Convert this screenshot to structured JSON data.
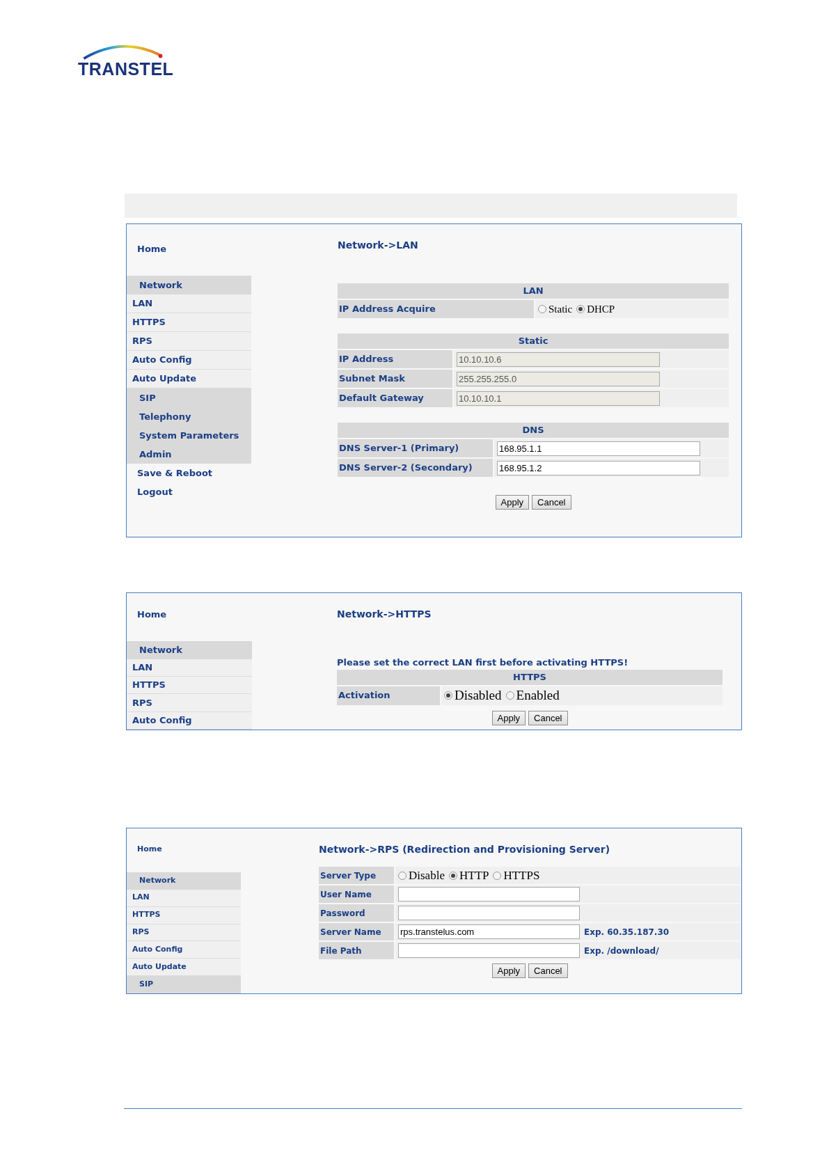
{
  "logo": {
    "text": "TRANSTEL"
  },
  "panels": [
    {
      "sidebar": [
        {
          "label": "Home",
          "kind": "link"
        },
        {
          "label": "Network",
          "kind": "section"
        },
        {
          "label": "LAN",
          "kind": "item"
        },
        {
          "label": "HTTPS",
          "kind": "item"
        },
        {
          "label": "RPS",
          "kind": "item"
        },
        {
          "label": "Auto Config",
          "kind": "item"
        },
        {
          "label": "Auto Update",
          "kind": "item"
        },
        {
          "label": "SIP",
          "kind": "sub"
        },
        {
          "label": "Telephony",
          "kind": "sub"
        },
        {
          "label": "System Parameters",
          "kind": "sub"
        },
        {
          "label": "Admin",
          "kind": "sub"
        },
        {
          "label": "Save & Reboot",
          "kind": "link"
        },
        {
          "label": "Logout",
          "kind": "link"
        }
      ],
      "title": "Network->LAN",
      "groups": [
        {
          "heading": "LAN",
          "rows": [
            {
              "label": "IP Address Acquire",
              "kind": "radio",
              "options": [
                {
                  "label": "Static",
                  "selected": false
                },
                {
                  "label": "DHCP",
                  "selected": true
                }
              ]
            }
          ]
        },
        {
          "heading": "Static",
          "rows": [
            {
              "label": "IP Address",
              "kind": "input",
              "value": "10.10.10.6",
              "disabled": true
            },
            {
              "label": "Subnet Mask",
              "kind": "input",
              "value": "255.255.255.0",
              "disabled": true
            },
            {
              "label": "Default Gateway",
              "kind": "input",
              "value": "10.10.10.1",
              "disabled": true
            }
          ]
        },
        {
          "heading": "DNS",
          "rows": [
            {
              "label": "DNS Server-1 (Primary)",
              "kind": "input",
              "value": "168.95.1.1",
              "disabled": false
            },
            {
              "label": "DNS Server-2 (Secondary)",
              "kind": "input",
              "value": "168.95.1.2",
              "disabled": false
            }
          ]
        }
      ],
      "buttons": [
        "Apply",
        "Cancel"
      ]
    },
    {
      "sidebar": [
        {
          "label": "Home",
          "kind": "link"
        },
        {
          "label": "Network",
          "kind": "section"
        },
        {
          "label": "LAN",
          "kind": "item"
        },
        {
          "label": "HTTPS",
          "kind": "item"
        },
        {
          "label": "RPS",
          "kind": "item"
        },
        {
          "label": "Auto Config",
          "kind": "item"
        }
      ],
      "title": "Network->HTTPS",
      "notice": "Please set the correct LAN first before activating HTTPS!",
      "groups": [
        {
          "heading": "HTTPS",
          "rows": [
            {
              "label": "Activation",
              "kind": "radio",
              "options": [
                {
                  "label": "Disabled",
                  "selected": true
                },
                {
                  "label": "Enabled",
                  "selected": false
                }
              ]
            }
          ]
        }
      ],
      "buttons": [
        "Apply",
        "Cancel"
      ]
    },
    {
      "sidebar": [
        {
          "label": "Home",
          "kind": "link"
        },
        {
          "label": "Network",
          "kind": "section"
        },
        {
          "label": "LAN",
          "kind": "item"
        },
        {
          "label": "HTTPS",
          "kind": "item"
        },
        {
          "label": "RPS",
          "kind": "item"
        },
        {
          "label": "Auto Config",
          "kind": "item"
        },
        {
          "label": "Auto Update",
          "kind": "item"
        },
        {
          "label": "SIP",
          "kind": "sub"
        }
      ],
      "title": "Network->RPS (Redirection and Provisioning Server)",
      "groups": [
        {
          "rows": [
            {
              "label": "Server Type",
              "kind": "radio",
              "options": [
                {
                  "label": "Disable",
                  "selected": false
                },
                {
                  "label": "HTTP",
                  "selected": true
                },
                {
                  "label": "HTTPS",
                  "selected": false
                }
              ]
            },
            {
              "label": "User Name",
              "kind": "input",
              "disabled": false
            },
            {
              "label": "Password",
              "kind": "input",
              "disabled": false
            },
            {
              "label": "Server Name",
              "kind": "input",
              "value": "rps.transtelus.com",
              "disabled": false,
              "hint": "Exp. 60.35.187.30"
            },
            {
              "label": "File Path",
              "kind": "input",
              "disabled": false,
              "hint": "Exp. /download/"
            }
          ]
        }
      ],
      "buttons": [
        "Apply",
        "Cancel"
      ]
    }
  ]
}
